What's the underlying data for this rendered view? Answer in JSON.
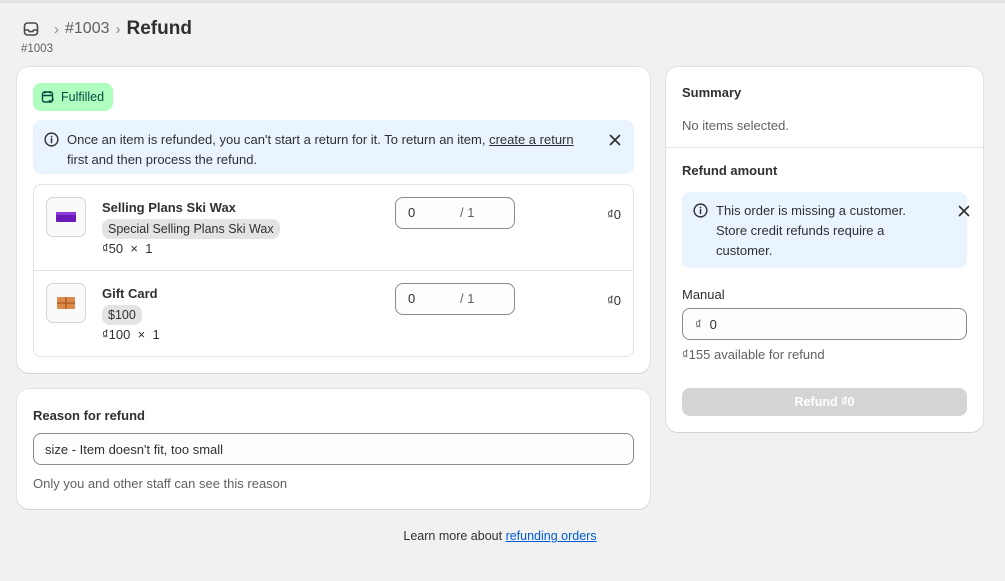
{
  "breadcrumb": {
    "home_icon": "inbox-icon",
    "order": "#1003",
    "current": "Refund",
    "separator": "›"
  },
  "subtitle": "#1003",
  "items_card": {
    "status_badge": "Fulfilled",
    "banner": {
      "text_before": "Once an item is refunded, you can't start a return for it. To return an item, ",
      "link": "create a return",
      "text_after": " first and then process the refund."
    },
    "items": [
      {
        "title": "Selling Plans Ski Wax",
        "variant": "Special Selling Plans Ski Wax",
        "price": "₫50",
        "times": "×",
        "quantity": "1",
        "qty_value": "0",
        "qty_max": "/ 1",
        "total": "₫0",
        "thumb_color": "#6a1ab8"
      },
      {
        "title": "Gift Card",
        "variant": "$100",
        "price": "₫100",
        "times": "×",
        "quantity": "1",
        "qty_value": "0",
        "qty_max": "/ 1",
        "total": "₫0",
        "thumb_color": "#d98a4a"
      }
    ]
  },
  "reason_card": {
    "title": "Reason for refund",
    "value": "size - Item doesn't fit, too small",
    "help": "Only you and other staff can see this reason"
  },
  "learn_more": {
    "text": "Learn more about ",
    "link": "refunding orders"
  },
  "summary_card": {
    "title": "Summary",
    "empty": "No items selected.",
    "refund_title": "Refund amount",
    "banner_text": "This order is missing a customer. Store credit refunds require a customer.",
    "manual_label": "Manual",
    "manual_currency": "₫",
    "manual_value": "0",
    "available": "₫155 available for refund",
    "refund_button": "Refund ₫0"
  },
  "colors": {
    "badge_bg": "#affebf",
    "banner_bg": "#eaf4ff",
    "link": "#005bd3",
    "button_disabled": "#d4d4d4"
  }
}
